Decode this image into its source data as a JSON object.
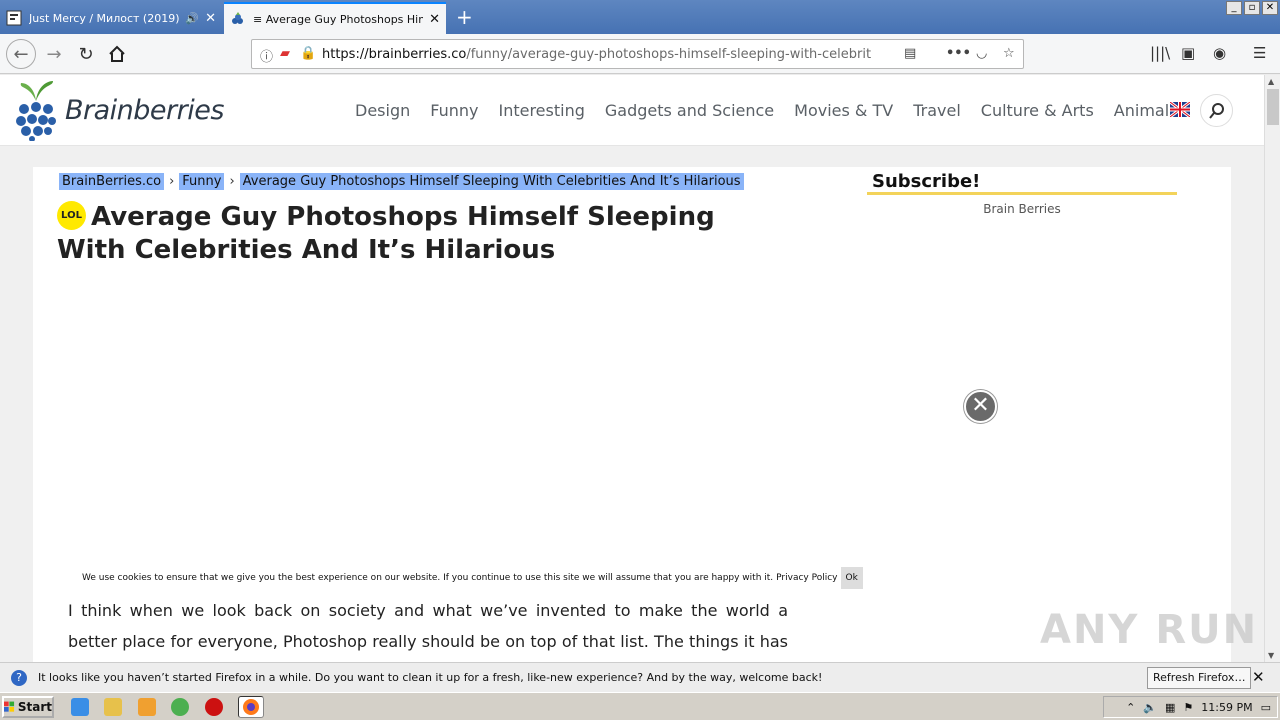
{
  "browser": {
    "tabs": [
      {
        "title": "Just Mercy / Милост (2019) »",
        "active": false,
        "has_audio": true
      },
      {
        "title": "≡ Average Guy Photoshops Himse",
        "active": true
      }
    ],
    "new_tab_label": "+",
    "window_controls": [
      "_",
      "▫",
      "✕"
    ],
    "url_domain": "https://brainberries.co",
    "url_path": "/funny/average-guy-photoshops-himself-sleeping-with-celebrities-and-its",
    "toolbar_icons": [
      "reader-view-icon",
      "more-icon",
      "pocket-icon",
      "bookmark-star-icon",
      "library-icon",
      "sidebar-icon",
      "account-icon",
      "menu-icon"
    ]
  },
  "site": {
    "logo_text": "Brainberries",
    "nav": [
      "Design",
      "Funny",
      "Interesting",
      "Gadgets and Science",
      "Movies & TV",
      "Travel",
      "Culture & Arts",
      "Animals"
    ],
    "accent": "#ffe900"
  },
  "article": {
    "breadcrumbs": [
      "BrainBerries.co",
      "Funny",
      "Average Guy Photoshops Himself Sleeping With Celebrities And It’s Hilarious"
    ],
    "badge": "LOL",
    "title": "Average Guy Photoshops Himself Sleeping With Celebrities And It’s Hilarious",
    "body": "I think when we look back on society and what we’ve invented to make the world a better place for everyone, Photoshop really should be on top of that list. The things it has allowed so"
  },
  "cookie": {
    "text": "We use cookies to ensure that we give you the best experience on our website. If you continue to use this site we will assume that you are happy with it.",
    "policy": "Privacy Policy",
    "ok": "Ok"
  },
  "sidebar": {
    "subscribe": "Subscribe!",
    "channel": "Brain Berries"
  },
  "watermark": "ANY RUN",
  "notification": {
    "message": "It looks like you haven’t started Firefox in a while. Do you want to clean it up for a fresh, like-new experience? And by the way, welcome back!",
    "button": "Refresh Firefox…"
  },
  "taskbar": {
    "start": "Start",
    "clock": "11:59 PM"
  }
}
